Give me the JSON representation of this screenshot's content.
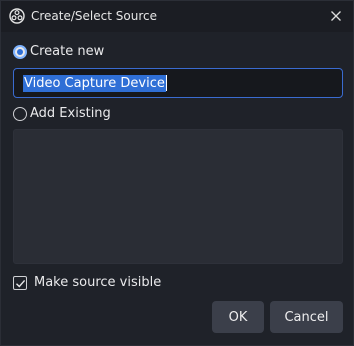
{
  "window": {
    "title": "Create/Select Source",
    "icons": {
      "app": "obs-logo-icon",
      "close": "close-icon"
    }
  },
  "options": {
    "create_new_label": "Create new",
    "create_new_selected": true,
    "add_existing_label": "Add Existing",
    "add_existing_selected": false
  },
  "name_input": {
    "value": "Video Capture Device",
    "text_selected": true
  },
  "existing_sources": [],
  "visibility": {
    "label": "Make source visible",
    "checked": true
  },
  "buttons": {
    "ok": "OK",
    "cancel": "Cancel"
  },
  "colors": {
    "background": "#1f2229",
    "accent": "#2f6fd6",
    "button": "#3b3f4a"
  }
}
